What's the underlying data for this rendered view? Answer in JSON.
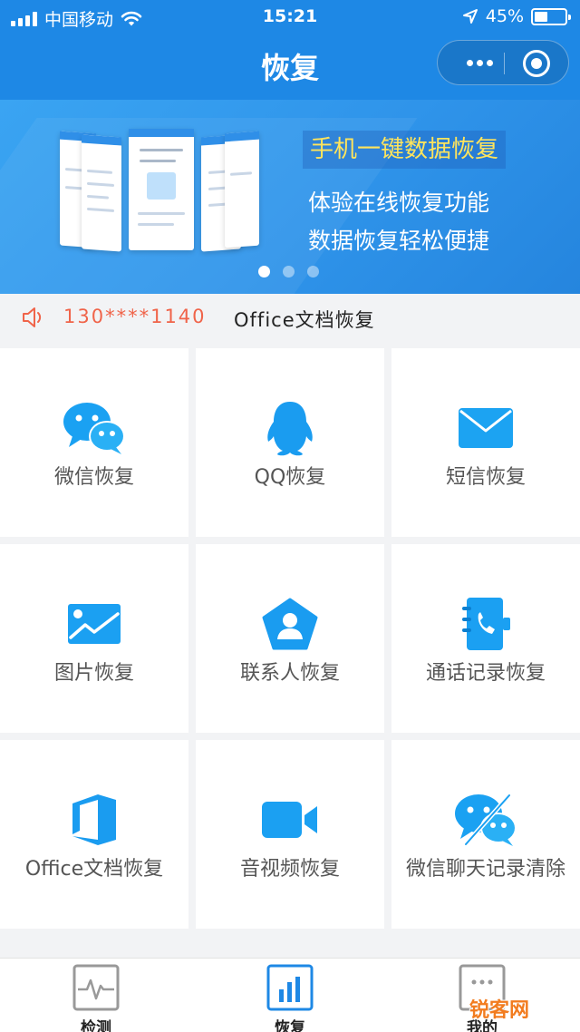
{
  "status_bar": {
    "carrier": "中国移动",
    "time": "15:21",
    "battery": "45%",
    "battery_level": 0.45
  },
  "nav": {
    "title": "恢复",
    "more_icon": "more-dots-icon",
    "close_icon": "target-icon"
  },
  "banner": {
    "headline": "手机一键数据恢复",
    "line1": "体验在线恢复功能",
    "line2": "数据恢复轻松便捷",
    "page_count": 3,
    "active_page": 1,
    "colors": {
      "headline": "#ffe45c",
      "background": "#2f94ea"
    }
  },
  "notice": {
    "icon": "speaker-icon",
    "phone": "130****1140",
    "text": "Office文档恢复"
  },
  "grid": [
    {
      "label": "微信恢复",
      "icon": "wechat-icon"
    },
    {
      "label": "QQ恢复",
      "icon": "qq-penguin-icon"
    },
    {
      "label": "短信恢复",
      "icon": "envelope-icon"
    },
    {
      "label": "图片恢复",
      "icon": "image-icon"
    },
    {
      "label": "联系人恢复",
      "icon": "contact-pentagon-icon"
    },
    {
      "label": "通话记录恢复",
      "icon": "phone-book-icon"
    },
    {
      "label": "Office文档恢复",
      "icon": "office-icon"
    },
    {
      "label": "音视频恢复",
      "icon": "video-camera-icon"
    },
    {
      "label": "微信聊天记录清除",
      "icon": "wechat-clear-icon"
    }
  ],
  "tabbar": [
    {
      "label": "检测",
      "icon": "pulse-monitor-icon",
      "active": false
    },
    {
      "label": "恢复",
      "icon": "bar-chart-icon",
      "active": true
    },
    {
      "label": "我的",
      "icon": "profile-icon",
      "active": false
    }
  ],
  "watermark": "锐客网",
  "accent_color": "#1e88e5"
}
